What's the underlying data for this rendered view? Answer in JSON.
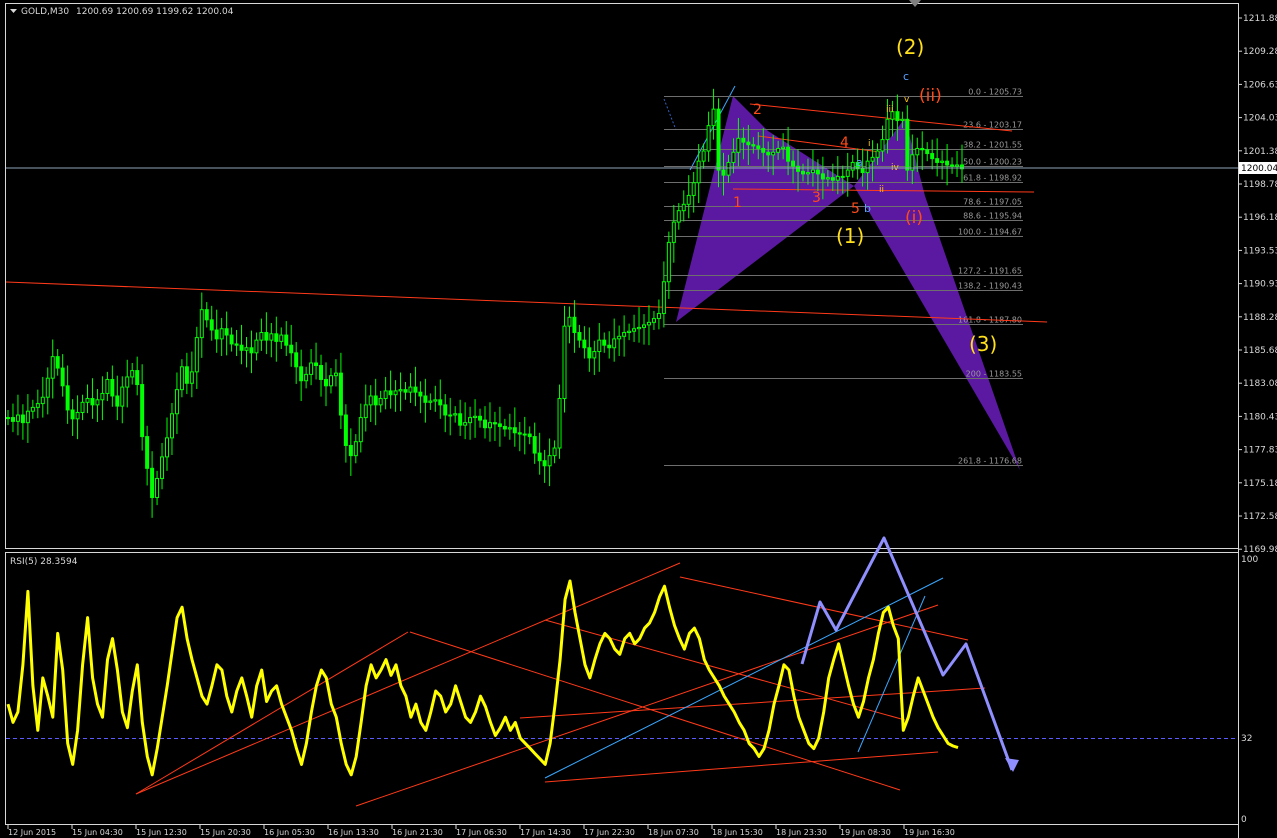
{
  "colors": {
    "background": "#000000",
    "frame": "#d8d8d8",
    "text": "#d8d8d8",
    "candle": "#00ff00",
    "purple_fill": "#5a19a0",
    "red_line": "#ff3a1a",
    "fib_line": "#6e6e6e",
    "yellow_label": "#ffe01a",
    "red_label": "#ff4b1a",
    "blue_label": "#5aa0ff",
    "rsi_line": "#ffff00",
    "arrow": "#8f8fff",
    "cyan_line": "#3aa8ff",
    "level_line": "#5a5aff"
  },
  "header": {
    "triangle_icon": "down-triangle-icon",
    "symbol": "GOLD,M30",
    "ohlc": "1200.69 1200.69 1199.62 1200.04"
  },
  "price_axis": {
    "ticks": [
      "1211.88",
      "1209.28",
      "1206.63",
      "1204.03",
      "1201.38",
      "1198.78",
      "1196.18",
      "1193.53",
      "1190.93",
      "1188.28",
      "1185.68",
      "1183.08",
      "1180.43",
      "1177.83",
      "1175.18",
      "1172.58",
      "1169.98"
    ],
    "current_price": "1200.04"
  },
  "time_axis": {
    "labels": [
      "12 Jun 2015",
      "15 Jun 04:30",
      "15 Jun 12:30",
      "15 Jun 20:30",
      "16 Jun 05:30",
      "16 Jun 13:30",
      "16 Jun 21:30",
      "17 Jun 06:30",
      "17 Jun 14:30",
      "17 Jun 22:30",
      "18 Jun 07:30",
      "18 Jun 15:30",
      "18 Jun 23:30",
      "19 Jun 08:30",
      "19 Jun 16:30"
    ]
  },
  "fibonacci": {
    "levels": [
      "0.0 - 1205.73",
      "23.6 - 1203.17",
      "38.2 - 1201.55",
      "50.0 - 1200.23",
      "61.8 - 1198.92",
      "78.6 - 1197.05",
      "88.6 - 1195.94",
      "100.0 - 1194.67",
      "127.2 - 1191.65",
      "138.2 - 1190.43",
      "161.8 - 1187.80",
      "200 - 1183.55",
      "261.8 - 1176.68"
    ]
  },
  "wave_labels": {
    "major_yellow": [
      "(1)",
      "(2)",
      "(3)"
    ],
    "minor_red": [
      "1",
      "2",
      "3",
      "4",
      "5"
    ],
    "roman_red": [
      "(i)",
      "(ii)"
    ],
    "abc_blue": [
      "a",
      "b",
      "c"
    ],
    "sub_waves": [
      "i",
      "ii",
      "iii",
      "iv",
      "v"
    ]
  },
  "rsi": {
    "title": "RSI(5) 28.3594",
    "axis_labels": [
      "100",
      "32",
      "0"
    ]
  },
  "chart_data": {
    "type": "candlestick",
    "title": "GOLD,M30",
    "timeframe": "M30",
    "ylim": [
      1169.98,
      1211.88
    ],
    "x_labels": [
      "12 Jun 2015",
      "15 Jun 04:30",
      "15 Jun 12:30",
      "15 Jun 20:30",
      "16 Jun 05:30",
      "16 Jun 13:30",
      "16 Jun 21:30",
      "17 Jun 06:30",
      "17 Jun 14:30",
      "17 Jun 22:30",
      "18 Jun 07:30",
      "18 Jun 15:30",
      "18 Jun 23:30",
      "19 Jun 08:30",
      "19 Jun 16:30"
    ],
    "last_ohlc": {
      "open": 1200.69,
      "high": 1200.69,
      "low": 1199.62,
      "close": 1200.04
    },
    "close_series": [
      1180.4,
      1180.1,
      1180.6,
      1180.0,
      1180.9,
      1181.2,
      1181.5,
      1182.0,
      1183.5,
      1185.2,
      1184.3,
      1182.9,
      1181.0,
      1180.3,
      1180.8,
      1181.6,
      1181.9,
      1181.4,
      1181.8,
      1182.3,
      1183.4,
      1182.1,
      1181.3,
      1182.8,
      1183.6,
      1184.1,
      1183.0,
      1178.9,
      1176.4,
      1174.1,
      1175.6,
      1177.3,
      1178.8,
      1180.7,
      1182.6,
      1184.4,
      1183.1,
      1184.0,
      1186.7,
      1188.9,
      1188.1,
      1187.3,
      1186.6,
      1187.4,
      1186.9,
      1186.2,
      1186.1,
      1185.7,
      1185.9,
      1185.5,
      1186.5,
      1187.1,
      1186.5,
      1187.0,
      1186.4,
      1186.9,
      1186.1,
      1185.5,
      1184.4,
      1183.3,
      1183.8,
      1184.7,
      1184.5,
      1183.4,
      1182.9,
      1183.7,
      1183.9,
      1180.6,
      1178.2,
      1177.4,
      1178.5,
      1180.4,
      1181.4,
      1182.1,
      1181.4,
      1181.9,
      1182.5,
      1182.2,
      1182.5,
      1182.6,
      1182.4,
      1182.8,
      1182.4,
      1182.1,
      1181.6,
      1181.7,
      1181.8,
      1181.4,
      1180.6,
      1180.6,
      1180.7,
      1179.8,
      1180.0,
      1180.4,
      1180.5,
      1180.2,
      1179.6,
      1180.0,
      1179.9,
      1179.7,
      1179.5,
      1179.6,
      1179.2,
      1179.1,
      1179.1,
      1178.9,
      1177.6,
      1177.0,
      1176.6,
      1177.4,
      1178.0,
      1181.9,
      1187.6,
      1188.3,
      1187.1,
      1186.5,
      1185.9,
      1185.1,
      1185.6,
      1186.5,
      1186.1,
      1185.9,
      1186.6,
      1186.8,
      1187.1,
      1187.2,
      1187.4,
      1187.5,
      1187.7,
      1187.9,
      1188.2,
      1188.6,
      1191.1,
      1194.2,
      1195.8,
      1196.7,
      1197.2,
      1197.9,
      1198.9,
      1200.6,
      1201.4,
      1203.4,
      1204.7,
      1199.9,
      1199.5,
      1200.5,
      1201.3,
      1202.4,
      1202.1,
      1201.9,
      1201.8,
      1201.6,
      1201.3,
      1201.1,
      1201.3,
      1201.6,
      1201.7,
      1200.6,
      1200.2,
      1199.8,
      1199.6,
      1199.7,
      1199.9,
      1199.6,
      1199.2,
      1199.3,
      1199.1,
      1199.4,
      1199.4,
      1199.9,
      1200.5,
      1200.0,
      1199.7,
      1200.6,
      1200.9,
      1201.4,
      1202.3,
      1203.9,
      1204.5,
      1203.8,
      1203.9,
      1199.9,
      1201.1,
      1201.6,
      1201.5,
      1201.2,
      1200.8,
      1200.5,
      1200.6,
      1200.3,
      1200.2,
      1200.3,
      1200.0
    ],
    "fib_levels": [
      {
        "ratio": "0.0",
        "price": 1205.73
      },
      {
        "ratio": "23.6",
        "price": 1203.17
      },
      {
        "ratio": "38.2",
        "price": 1201.55
      },
      {
        "ratio": "50.0",
        "price": 1200.23
      },
      {
        "ratio": "61.8",
        "price": 1198.92
      },
      {
        "ratio": "78.6",
        "price": 1197.05
      },
      {
        "ratio": "88.6",
        "price": 1195.94
      },
      {
        "ratio": "100.0",
        "price": 1194.67
      },
      {
        "ratio": "127.2",
        "price": 1191.65
      },
      {
        "ratio": "138.2",
        "price": 1190.43
      },
      {
        "ratio": "161.8",
        "price": 1187.8
      },
      {
        "ratio": "200",
        "price": 1183.55
      },
      {
        "ratio": "261.8",
        "price": 1176.68
      }
    ],
    "rsi": {
      "period": 5,
      "last": 28.3594,
      "ylim": [
        0,
        100
      ],
      "level": 32,
      "values": [
        45,
        38,
        42,
        60,
        88,
        52,
        35,
        55,
        48,
        40,
        72,
        58,
        30,
        22,
        35,
        60,
        78,
        55,
        45,
        40,
        62,
        70,
        58,
        42,
        36,
        50,
        60,
        38,
        25,
        18,
        28,
        40,
        52,
        65,
        78,
        82,
        70,
        62,
        55,
        48,
        45,
        52,
        60,
        58,
        48,
        42,
        50,
        55,
        48,
        40,
        52,
        58,
        46,
        50,
        52,
        45,
        40,
        35,
        28,
        22,
        30,
        42,
        52,
        58,
        55,
        45,
        40,
        30,
        22,
        18,
        25,
        38,
        52,
        60,
        55,
        58,
        62,
        56,
        60,
        52,
        48,
        40,
        45,
        38,
        35,
        42,
        50,
        48,
        42,
        45,
        52,
        46,
        40,
        38,
        42,
        48,
        44,
        38,
        33,
        36,
        40,
        35,
        38,
        32,
        30,
        28,
        26,
        24,
        22,
        30,
        45,
        62,
        85,
        92,
        80,
        70,
        60,
        55,
        62,
        68,
        72,
        70,
        66,
        64,
        70,
        72,
        68,
        70,
        74,
        76,
        80,
        86,
        90,
        82,
        75,
        70,
        66,
        72,
        74,
        70,
        62,
        58,
        55,
        52,
        48,
        45,
        42,
        38,
        35,
        30,
        28,
        25,
        28,
        35,
        45,
        52,
        60,
        58,
        48,
        40,
        35,
        30,
        28,
        32,
        42,
        55,
        62,
        68,
        60,
        52,
        45,
        40,
        46,
        55,
        62,
        72,
        80,
        82,
        75,
        70,
        35,
        40,
        48,
        55,
        50,
        45,
        40,
        36,
        33,
        30,
        29,
        28.4
      ]
    },
    "ohlc_annotations": {
      "annotations": [
        "wave count (1)-(2)-(3)",
        "fibonacci extension",
        "trendlines"
      ]
    }
  }
}
